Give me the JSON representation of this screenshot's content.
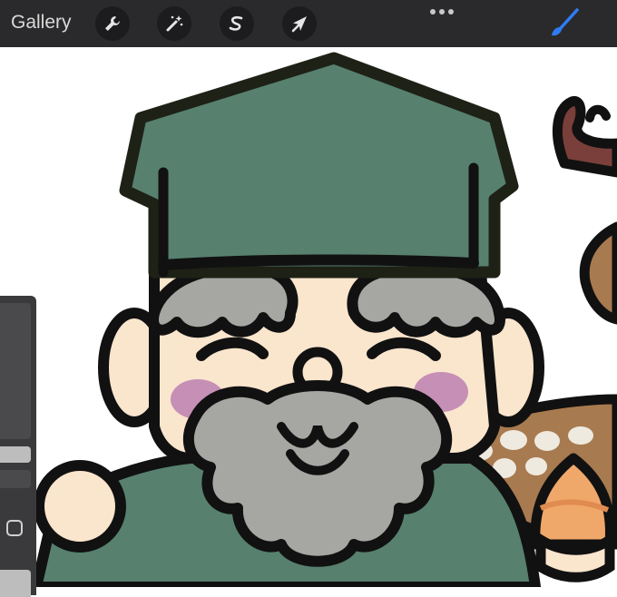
{
  "toolbar": {
    "gallery_label": "Gallery",
    "tools": [
      {
        "name": "actions",
        "icon": "wrench-icon"
      },
      {
        "name": "adjustments",
        "icon": "magic-wand-icon"
      },
      {
        "name": "selection",
        "icon": "selection-s-icon"
      },
      {
        "name": "transform",
        "icon": "arrow-cursor-icon"
      }
    ],
    "more_icon": "ellipsis-icon",
    "brush_icon": "brush-icon",
    "brush_color": "#2f7bf5"
  },
  "sidebar": {
    "brush_size_slider": "brush-size-slider",
    "modify_button_icon": "square-icon",
    "opacity_slider": "opacity-slider"
  },
  "canvas": {
    "artwork": "gnome-with-deer-illustration",
    "colors": {
      "hat": "#57806f",
      "outline": "#111111",
      "skin": "#fae5cd",
      "beard": "#a6a6a2",
      "cheek": "#c68fb6",
      "antler": "#7a3f3a",
      "deer": "#a87a4f",
      "deer_spots": "#eeeae0",
      "acorn": "#f0a86a"
    }
  }
}
